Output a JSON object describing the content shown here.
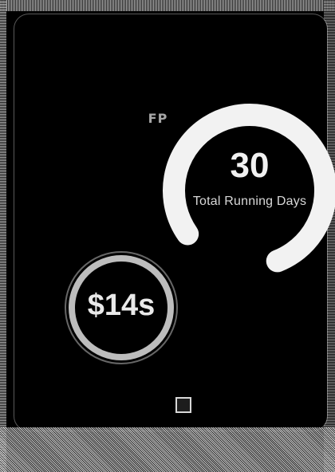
{
  "streak": {
    "value": "30",
    "label": "Total Running Days"
  },
  "savings": {
    "amount": "$14s"
  },
  "icons": {
    "top_badge": "badge-icon",
    "bottom_square": "square-icon"
  },
  "colors": {
    "background": "#000000",
    "ring": "#f2f2f2",
    "text": "#e9e9e9"
  }
}
